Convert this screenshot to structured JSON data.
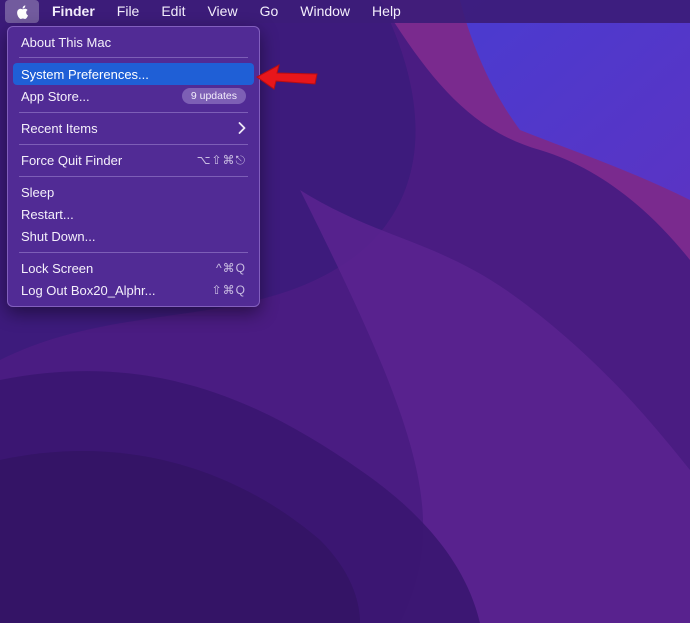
{
  "menubar": {
    "apple_icon": "apple-logo-icon",
    "items": [
      "Finder",
      "File",
      "Edit",
      "View",
      "Go",
      "Window",
      "Help"
    ]
  },
  "apple_menu": {
    "about": "About This Mac",
    "system_preferences": "System Preferences...",
    "app_store": "App Store...",
    "app_store_badge": "9 updates",
    "recent_items": "Recent Items",
    "recent_items_icon": "chevron-right-icon",
    "force_quit": "Force Quit Finder",
    "force_quit_shortcut": "⌥⇧⌘⎋",
    "sleep": "Sleep",
    "restart": "Restart...",
    "shut_down": "Shut Down...",
    "lock_screen": "Lock Screen",
    "lock_screen_shortcut": "^⌘Q",
    "log_out": "Log Out Box20_Alphr...",
    "log_out_shortcut": "⇧⌘Q"
  },
  "annotation": {
    "icon": "red-arrow-icon",
    "color": "#e8161b"
  },
  "colors": {
    "selection": "#1f5fd6",
    "wallpaper_base": "#3a1a78"
  }
}
